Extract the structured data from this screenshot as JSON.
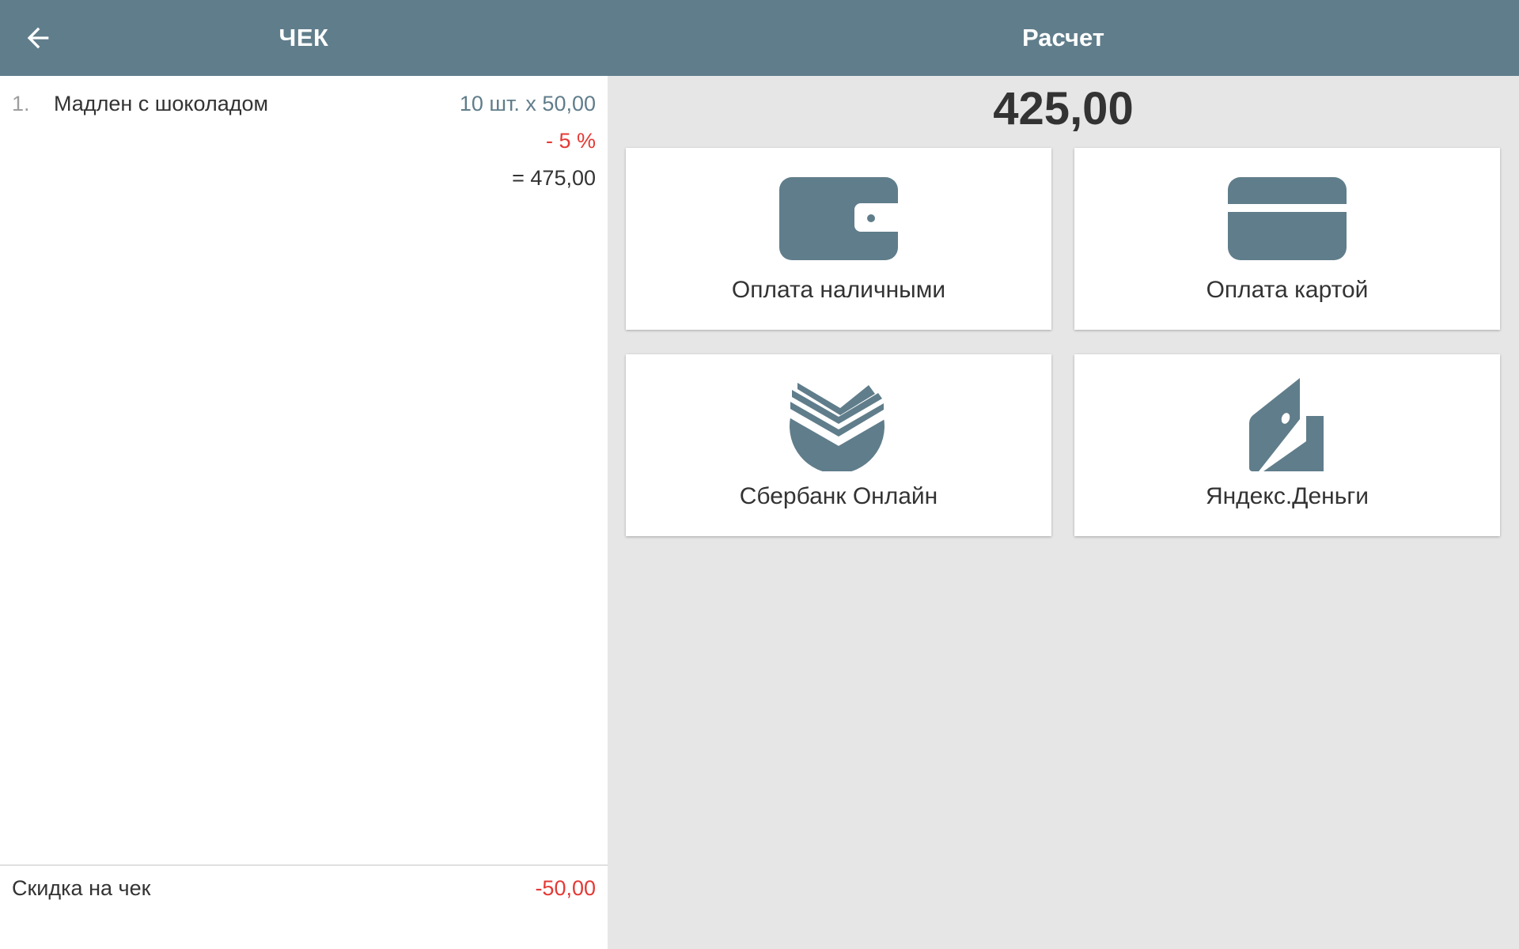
{
  "header": {
    "back_icon": "arrow-back-icon",
    "receipt_title": "ЧЕК",
    "payment_title": "Расчет"
  },
  "receipt": {
    "items": [
      {
        "index": "1.",
        "name": "Мадлен с шоколадом",
        "quantity_price": "10 шт. x 50,00",
        "discount": "- 5 %",
        "total": "= 475,00"
      }
    ],
    "footer": {
      "label": "Скидка на чек",
      "value": "-50,00"
    }
  },
  "payment": {
    "total": "425,00",
    "methods": [
      {
        "label": "Оплата наличными",
        "icon": "wallet-icon"
      },
      {
        "label": "Оплата картой",
        "icon": "credit-card-icon"
      },
      {
        "label": "Сбербанк Онлайн",
        "icon": "sberbank-logo-icon"
      },
      {
        "label": "Яндекс.Деньги",
        "icon": "yandex-money-icon"
      }
    ]
  },
  "colors": {
    "header": "#607d8b",
    "accent": "#607d8b",
    "discount": "#e53935",
    "panel_background": "#e6e6e6"
  }
}
